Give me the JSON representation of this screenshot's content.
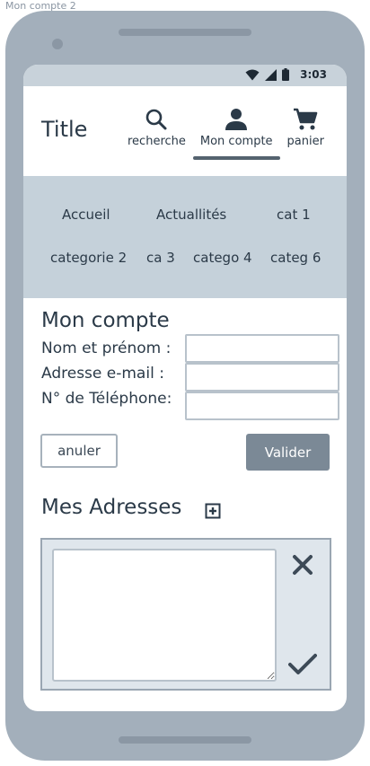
{
  "frame": {
    "label": "Mon compte 2"
  },
  "status_bar": {
    "time": "3:03"
  },
  "header": {
    "title": "Title",
    "nav": [
      {
        "label": "recherche",
        "icon": "search-icon",
        "active": false
      },
      {
        "label": "Mon compte",
        "icon": "user-icon",
        "active": true
      },
      {
        "label": "panier",
        "icon": "cart-icon",
        "active": false
      }
    ]
  },
  "categories": {
    "row1": [
      "Accueil",
      "Actuallités",
      "cat 1"
    ],
    "row2": [
      "categorie 2",
      "ca 3",
      "catego 4",
      "categ 6"
    ]
  },
  "form": {
    "title": "Mon compte",
    "name_label": "Nom et prénom :",
    "email_label": "Adresse e-mail :",
    "phone_label": "N° de Téléphone:",
    "name_value": "",
    "email_value": "",
    "phone_value": "",
    "cancel_label": "anuler",
    "submit_label": "Valider"
  },
  "addresses": {
    "title": "Mes Adresses",
    "add_icon": "add-box-icon",
    "textarea_value": "",
    "delete_icon": "close-icon",
    "confirm_icon": "check-icon"
  },
  "colors": {
    "device": "#a3afbb",
    "statusbar": "#c8d2da",
    "category_band": "#c5d1da",
    "primary_button": "#7b8996",
    "text": "#2b3a48"
  }
}
